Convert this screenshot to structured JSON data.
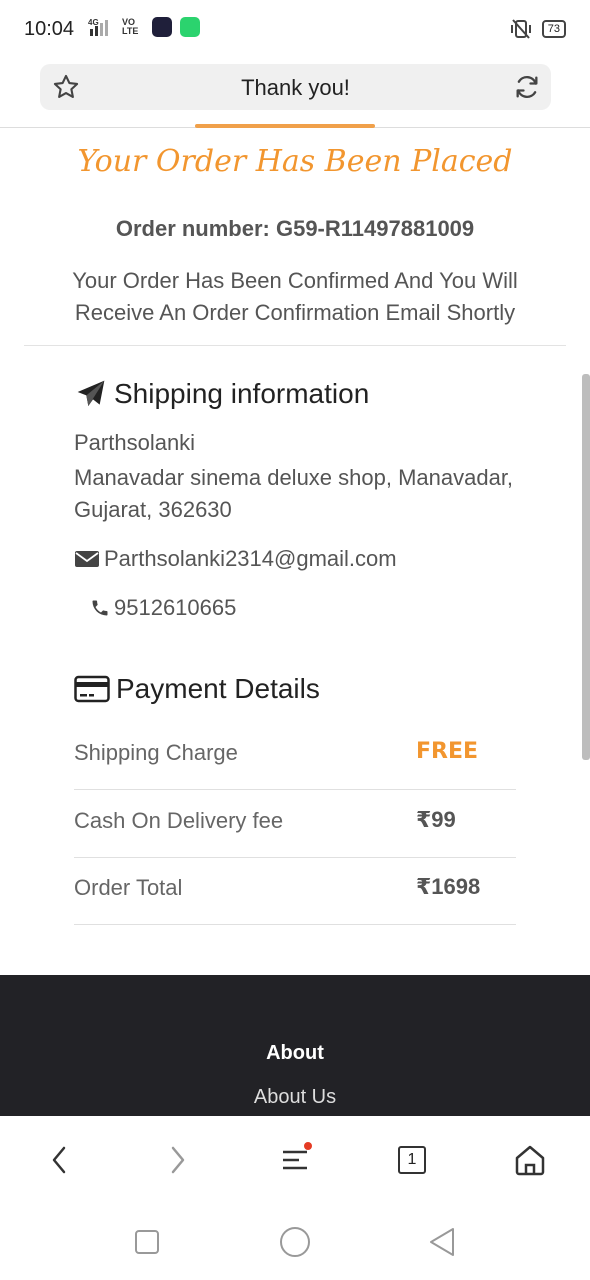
{
  "status_bar": {
    "time": "10:04",
    "network": "4G",
    "volte": "VO LTE",
    "battery": "73"
  },
  "address_bar": {
    "title": "Thank you!"
  },
  "order": {
    "placed_heading": "Your Order Has Been Placed",
    "number_label": "Order number: G59-R11497881009",
    "confirmation_text": "Your Order Has Been Confirmed And You Will Receive An Order Confirmation Email Shortly"
  },
  "shipping": {
    "heading": "Shipping information",
    "name": "Parthsolanki",
    "address": "Manavadar sinema deluxe shop, Manavadar, Gujarat, 362630",
    "email": "Parthsolanki2314@gmail.com",
    "phone": "9512610665"
  },
  "payment": {
    "heading": "Payment Details",
    "rows": [
      {
        "label": "Shipping Charge",
        "value": "FREE"
      },
      {
        "label": "Cash On Delivery fee",
        "value": "₹99"
      },
      {
        "label": "Order Total",
        "value": "₹1698"
      }
    ]
  },
  "footer": {
    "title": "About",
    "link": "About Us"
  },
  "toolbar": {
    "tab_count": "1"
  },
  "colors": {
    "accent": "#f2962f",
    "footer_bg": "#222226"
  }
}
